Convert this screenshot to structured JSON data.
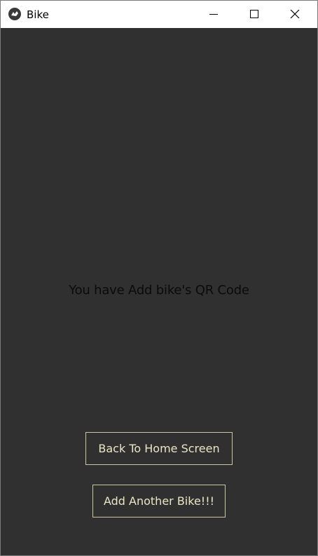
{
  "window": {
    "title": "Bike"
  },
  "icons": {
    "app": "kivy-app-icon",
    "minimize": "minimize-icon",
    "maximize": "maximize-icon",
    "close": "close-icon"
  },
  "main": {
    "message": "You have Add bike's QR Code",
    "back_button_label": "Back To Home Screen",
    "add_button_label": "Add Another Bike!!!"
  },
  "colors": {
    "background": "#303030",
    "button_border": "#c9c6a0",
    "button_text": "#e9e6c5",
    "message_text": "#0b0b0b"
  }
}
